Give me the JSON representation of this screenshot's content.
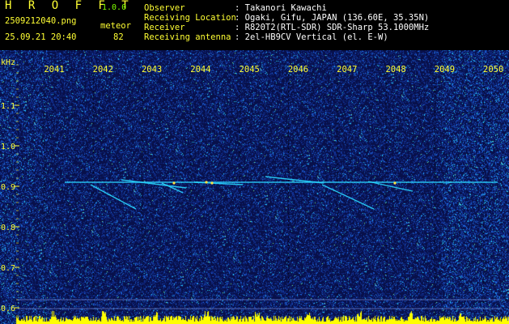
{
  "header": {
    "app_title": "H R O F F T",
    "app_version": "1.0.0",
    "file_name": "2509212040.png",
    "datetime": "25.09.21 20:40",
    "meteor_label": "meteor",
    "meteor_count": "82",
    "info": [
      {
        "label": "Observer",
        "value": ": Takanori Kawachi"
      },
      {
        "label": "Receiving Location",
        "value": ": Ogaki, Gifu, JAPAN (136.60E, 35.35N)"
      },
      {
        "label": "Receiver",
        "value": ": R820T2(RTL-SDR) SDR-Sharp 53.1000MHz"
      },
      {
        "label": "Receiving antenna",
        "value": ": 2el-HB9CV Vertical (el. E-W)"
      }
    ]
  },
  "axes": {
    "y_unit": "kHz",
    "y_ticks": [
      "1.1",
      "1.0",
      "0.9",
      "0.8",
      "0.7",
      "0.6"
    ],
    "x_ticks": [
      "2041",
      "2042",
      "2043",
      "2044",
      "2045",
      "2046",
      "2047",
      "2048",
      "2049",
      "2050"
    ]
  },
  "colors": {
    "header_text": "#ffff33",
    "info_text": "#ffffff",
    "version_text": "#7fff00",
    "background": "#08104a",
    "signal": "#2ad6ff",
    "level_bars": "#ffff00"
  }
}
